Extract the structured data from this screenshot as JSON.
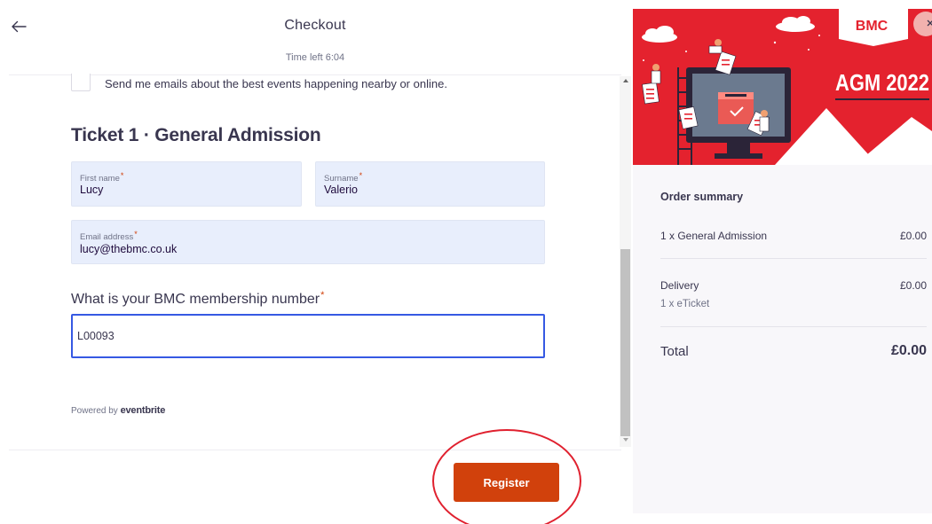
{
  "header": {
    "back_icon": "arrow-left-icon",
    "title": "Checkout",
    "time_left": "Time left 6:04"
  },
  "marketing": {
    "email_opt_in_label": "Send me emails about the best events happening nearby or online.",
    "checked": false
  },
  "ticket": {
    "heading": "Ticket 1 · General Admission",
    "first_name": {
      "label": "First name",
      "required_mark": "*",
      "value": "Lucy"
    },
    "surname": {
      "label": "Surname",
      "required_mark": "*",
      "value": "Valerio"
    },
    "email": {
      "label": "Email address",
      "required_mark": "*",
      "value": "lucy@thebmc.co.uk"
    }
  },
  "membership": {
    "question": "What is your BMC membership number",
    "required_mark": "*",
    "value": "L00093"
  },
  "footer": {
    "powered_by": "Powered by",
    "brand": "eventbrite",
    "register_label": "Register"
  },
  "banner": {
    "brand": "BMC",
    "title": "AGM 2022",
    "background_color": "#e4222e",
    "close_icon": "close-icon"
  },
  "order_summary": {
    "title": "Order summary",
    "items": [
      {
        "label": "1 x General Admission",
        "amount": "£0.00"
      }
    ],
    "delivery": {
      "label": "Delivery",
      "detail": "1 x eTicket",
      "amount": "£0.00"
    },
    "total": {
      "label": "Total",
      "amount": "£0.00"
    }
  },
  "colors": {
    "accent": "#d1410c",
    "focus": "#3659e3",
    "autofill": "#e8eefc",
    "annotation": "#e0212f"
  }
}
